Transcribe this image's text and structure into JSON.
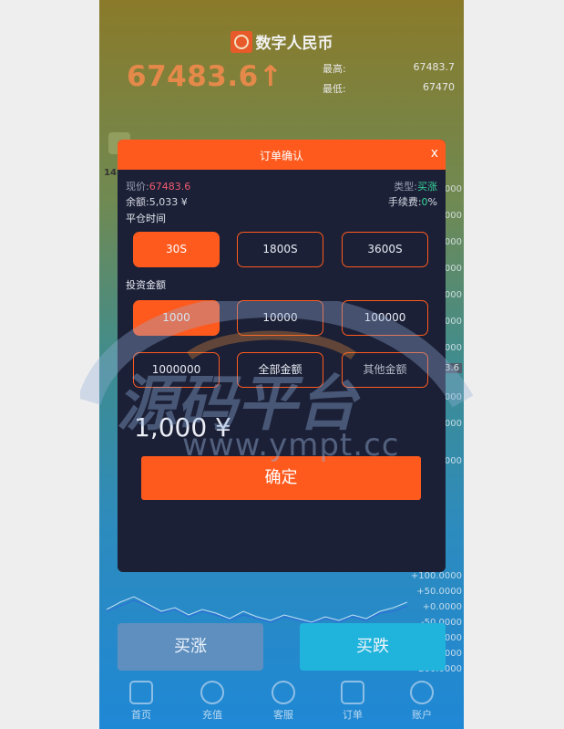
{
  "header": {
    "brand": "数字人民币",
    "price": "67483.6↑",
    "high_label": "最高:",
    "high_value": "67483.7",
    "low_label": "最低:",
    "low_value": "67470"
  },
  "background": {
    "time_label": "14:",
    "axis_values": [
      "0000",
      "0000",
      "0000",
      "0000",
      "0000",
      "0000",
      "0000",
      "3.6",
      "0000",
      "0000",
      "0000",
      "+100.0000",
      "+50.0000",
      "+0.0000",
      "-50.0000",
      "-100.0000",
      "-150.0000",
      "-200.0000"
    ]
  },
  "modal": {
    "title": "订单确认",
    "close": "x",
    "current_price_label": "现价:",
    "current_price": "67483.6",
    "type_label": "类型:",
    "type_value": "买涨",
    "balance_label": "余额:",
    "balance_value": "5,033 ¥",
    "fee_label": "手续费:",
    "fee_value": "0",
    "fee_unit": "%",
    "close_time_label": "平仓时间",
    "durations": [
      "30S",
      "1800S",
      "3600S"
    ],
    "invest_label": "投资金额",
    "amounts": [
      "1000",
      "10000",
      "100000",
      "1000000",
      "全部金额"
    ],
    "other_amount_placeholder": "其他金额",
    "amount_display": "1,000 ¥",
    "confirm_label": "确定"
  },
  "actions": {
    "buy_up": "买涨",
    "buy_down": "买跌"
  },
  "tabs": [
    "首页",
    "充值",
    "客服",
    "订单",
    "账户"
  ],
  "watermark": {
    "logo_text": "源码平台",
    "url": "www.ympt.cc"
  },
  "colors": {
    "accent": "#ff5a1e",
    "modal_bg": "#1b2036",
    "price": "#e5894a",
    "up": "#5f8fbf",
    "down": "#20b4dc"
  }
}
